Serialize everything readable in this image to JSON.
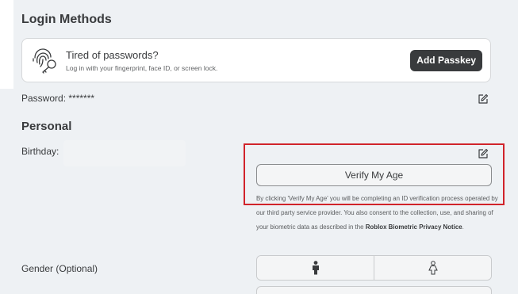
{
  "login_methods": {
    "title": "Login Methods",
    "passkey": {
      "title": "Tired of passwords?",
      "description": "Log in with your fingerprint, face ID, or screen lock.",
      "button": "Add Passkey"
    },
    "password_label": "Password: *******"
  },
  "personal": {
    "title": "Personal",
    "birthday_label": "Birthday:",
    "verify_button": "Verify My Age",
    "notice": {
      "text": "By clicking 'Verify My Age' you will be completing an ID verification process operated by our third party service provider. You also consent to the collection, use, and sharing of your biometric data as described in the ",
      "link": "Roblox Biometric Privacy Notice",
      "end": "."
    },
    "gender_label": "Gender (Optional)",
    "gender_options": [
      "male-icon",
      "female-icon"
    ]
  },
  "colors": {
    "highlight": "#d1232a",
    "dark_button": "#393b3d",
    "background": "#eef1f4"
  }
}
